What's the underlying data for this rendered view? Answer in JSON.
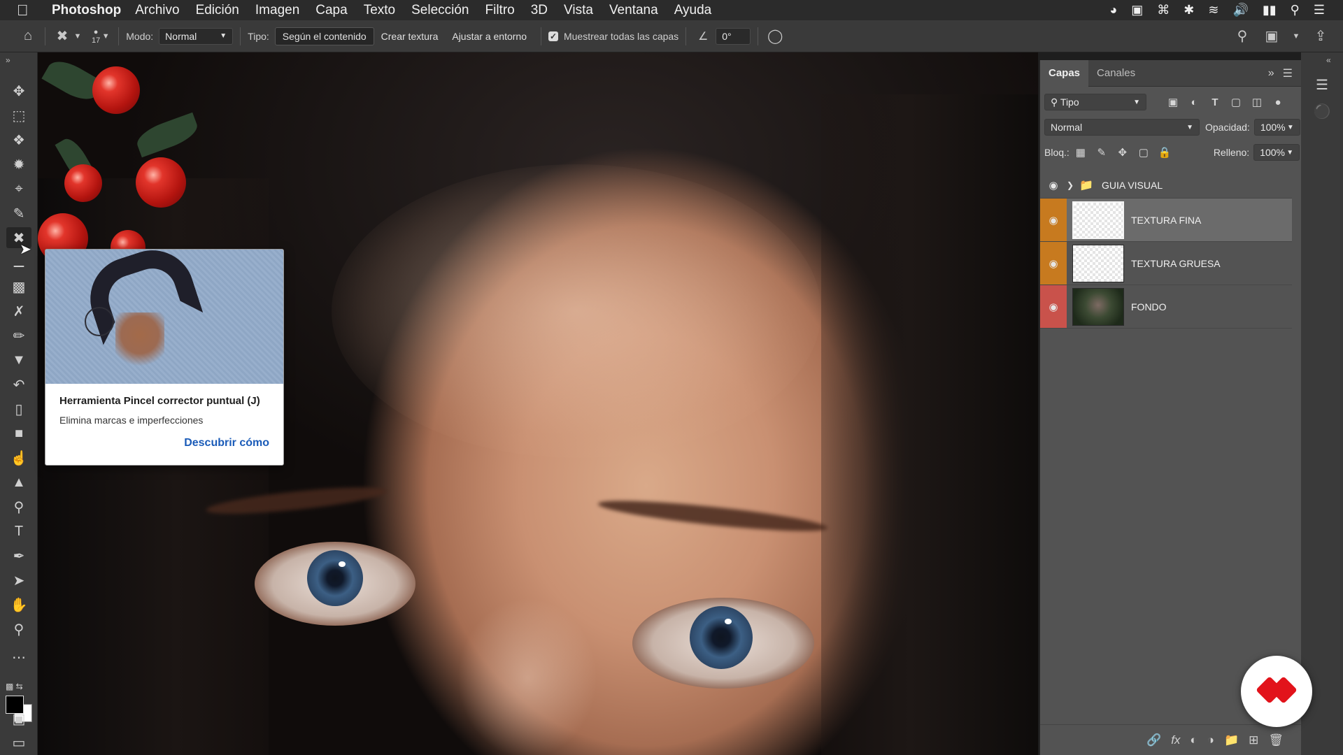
{
  "menubar": {
    "app_name": "Photoshop",
    "items": [
      "Archivo",
      "Edición",
      "Imagen",
      "Capa",
      "Texto",
      "Selección",
      "Filtro",
      "3D",
      "Vista",
      "Ventana",
      "Ayuda"
    ]
  },
  "options": {
    "brush_size": "17",
    "mode_label": "Modo:",
    "mode_value": "Normal",
    "type_label": "Tipo:",
    "type_options": [
      "Según el contenido",
      "Crear textura",
      "Ajustar a entorno"
    ],
    "sample_all_label": "Muestrear todas las capas",
    "angle_value": "0°"
  },
  "tooltip": {
    "title": "Herramienta Pincel corrector puntual (J)",
    "description": "Elimina marcas e imperfecciones",
    "link": "Descubrir cómo"
  },
  "layers_panel": {
    "tabs": [
      "Capas",
      "Canales"
    ],
    "filter_label": "Tipo",
    "blend_mode": "Normal",
    "opacity_label": "Opacidad:",
    "opacity_value": "100%",
    "lock_label": "Bloq.:",
    "fill_label": "Relleno:",
    "fill_value": "100%",
    "layers": [
      {
        "name": "GUIA VISUAL",
        "kind": "group",
        "visible": true,
        "color": null
      },
      {
        "name": "TEXTURA FINA",
        "kind": "layer",
        "visible": true,
        "color": "#c77a1f",
        "selected": true
      },
      {
        "name": "TEXTURA GRUESA",
        "kind": "layer",
        "visible": true,
        "color": "#c77a1f"
      },
      {
        "name": "FONDO",
        "kind": "layer",
        "visible": true,
        "color": "#c9524b"
      }
    ]
  },
  "colors": {
    "accent_link": "#1a5bb8",
    "badge_red": "#e2131b"
  }
}
